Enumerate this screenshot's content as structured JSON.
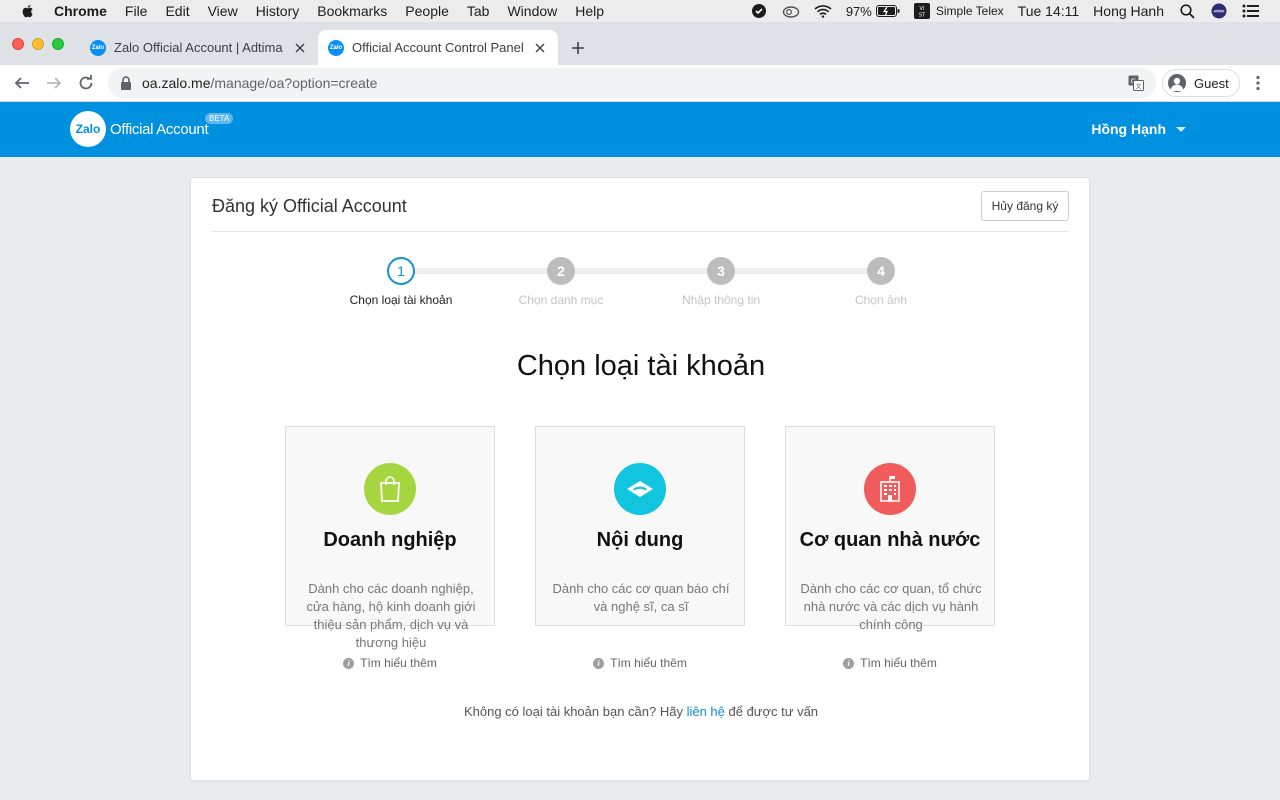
{
  "menubar": {
    "app_name": "Chrome",
    "items": [
      "File",
      "Edit",
      "View",
      "History",
      "Bookmarks",
      "People",
      "Tab",
      "Window",
      "Help"
    ],
    "battery": "97%",
    "simple_telex": "Simple Telex",
    "clock": "Tue 14:11",
    "user": "Hong Hanh"
  },
  "tabs": [
    {
      "title": "Zalo Official Account | Adtima",
      "favicon": "Zalo"
    },
    {
      "title": "Official Account Control Panel",
      "favicon": "Zalo"
    }
  ],
  "toolbar": {
    "url_host": "oa.zalo.me",
    "url_path": "/manage/oa?option=create",
    "profile": "Guest"
  },
  "header": {
    "logo_bubble": "Zalo",
    "logo_text": "Official Account",
    "beta": "BETA",
    "user_name": "Hồng Hạnh"
  },
  "card": {
    "title": "Đăng ký Official Account",
    "cancel_label": "Hủy đăng ký",
    "steps": [
      {
        "number": "1",
        "label": "Chọn loại tài khoản",
        "active": true
      },
      {
        "number": "2",
        "label": "Chọn danh mục",
        "active": false
      },
      {
        "number": "3",
        "label": "Nhập thông tin",
        "active": false
      },
      {
        "number": "4",
        "label": "Chọn ảnh",
        "active": false
      }
    ],
    "heading": "Chọn loại tài khoản",
    "types": [
      {
        "name": "Doanh nghiệp",
        "description": "Dành cho các doanh nghiệp, cửa hàng, hộ kinh doanh giới thiệu sản phẩm, dịch vụ và thương hiệu",
        "more": "Tìm hiểu thêm",
        "icon": "shopping-bag-icon",
        "color": "#a5d63f"
      },
      {
        "name": "Nội dung",
        "description": "Dành cho các cơ quan báo chí và nghệ sĩ, ca sĩ",
        "more": "Tìm hiểu thêm",
        "icon": "content-icon",
        "color": "#12c5de"
      },
      {
        "name": "Cơ quan nhà nước",
        "description": "Dành cho các cơ quan, tổ chức nhà nước và các dịch vụ hành chính công",
        "more": "Tìm hiểu thêm",
        "icon": "government-building-icon",
        "color": "#f25b5b"
      }
    ],
    "footer_prefix": "Không có loại tài khoản bạn cần? Hãy ",
    "footer_link": "liên hệ",
    "footer_suffix": " để được tư vấn"
  },
  "colors": {
    "header_blue": "#0090e0",
    "step_active": "#1190dd",
    "link": "#0e8fd9"
  }
}
